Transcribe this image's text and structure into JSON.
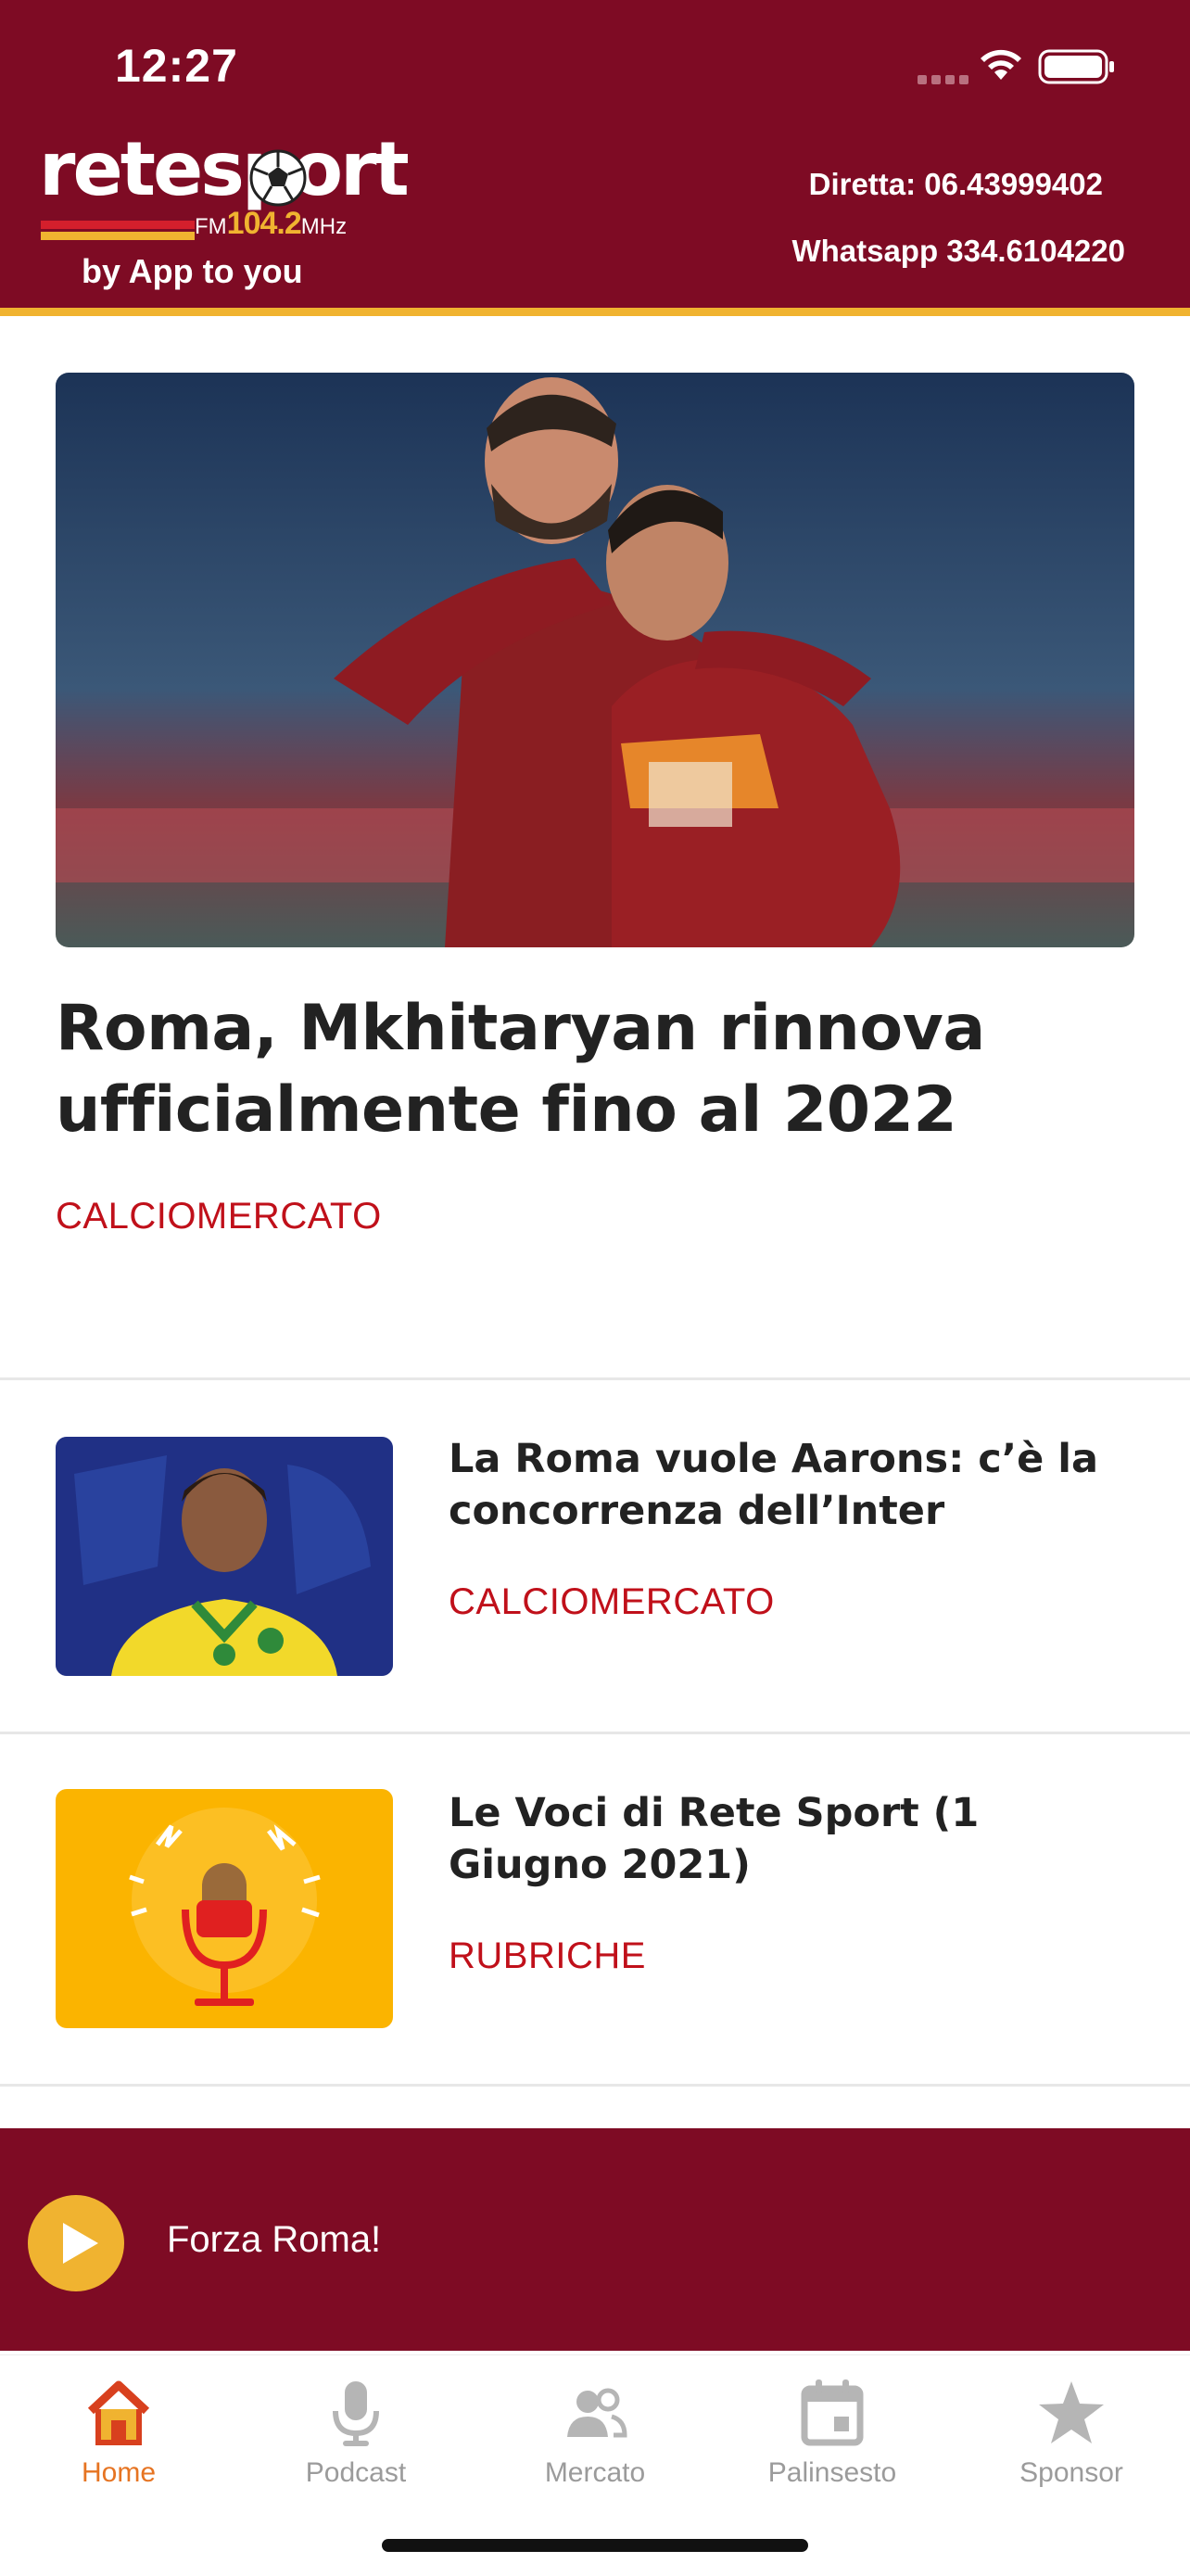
{
  "status_bar": {
    "time": "12:27"
  },
  "header": {
    "logo_word": "retesport",
    "logo_band": "FM",
    "logo_frequency": "104.2",
    "logo_unit": "MHz",
    "tagline": "by App to you",
    "phone_label": "Diretta: 06.43999402",
    "whatsapp_label": "Whatsapp 334.6104220"
  },
  "hero": {
    "title": "Roma, Mkhitaryan rinnova ufficialmente fino al 2022",
    "category": "CALCIOMERCATO"
  },
  "articles": [
    {
      "title": "La Roma vuole Aarons: c’è la concorrenza dell’Inter",
      "category": "CALCIOMERCATO"
    },
    {
      "title": "Le Voci di Rete Sport (1 Giugno 2021)",
      "category": "RUBRICHE"
    }
  ],
  "player": {
    "title": "Forza Roma!"
  },
  "tabs": [
    {
      "label": "Home",
      "icon": "home-icon",
      "active": true
    },
    {
      "label": "Podcast",
      "icon": "microphone-icon",
      "active": false
    },
    {
      "label": "Mercato",
      "icon": "users-icon",
      "active": false
    },
    {
      "label": "Palinsesto",
      "icon": "calendar-icon",
      "active": false
    },
    {
      "label": "Sponsor",
      "icon": "star-icon",
      "active": false
    }
  ],
  "colors": {
    "brand": "#7e0b24",
    "accent": "#f0b330",
    "category": "#c0101a",
    "tab_active": "#e67422"
  }
}
